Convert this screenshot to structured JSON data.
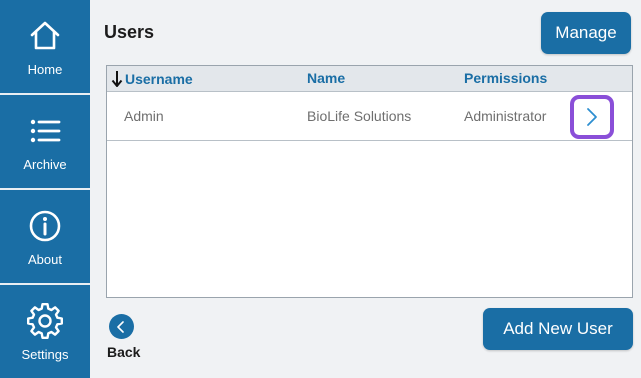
{
  "sidebar": {
    "items": [
      {
        "label": "Home",
        "icon": "home-icon"
      },
      {
        "label": "Archive",
        "icon": "list-icon"
      },
      {
        "label": "About",
        "icon": "info-icon"
      },
      {
        "label": "Settings",
        "icon": "gear-icon"
      }
    ]
  },
  "header": {
    "title": "Users",
    "manage_label": "Manage"
  },
  "table": {
    "columns": [
      "Username",
      "Name",
      "Permissions"
    ],
    "sort_icon": "arrow-down-icon",
    "rows": [
      {
        "username": "Admin",
        "name": "BioLife Solutions",
        "permissions": "Administrator"
      }
    ]
  },
  "footer": {
    "back_label": "Back",
    "add_label": "Add New User"
  },
  "colors": {
    "primary": "#1a6ea5",
    "highlight": "#8a4fd8",
    "background": "#f0f2f4"
  }
}
